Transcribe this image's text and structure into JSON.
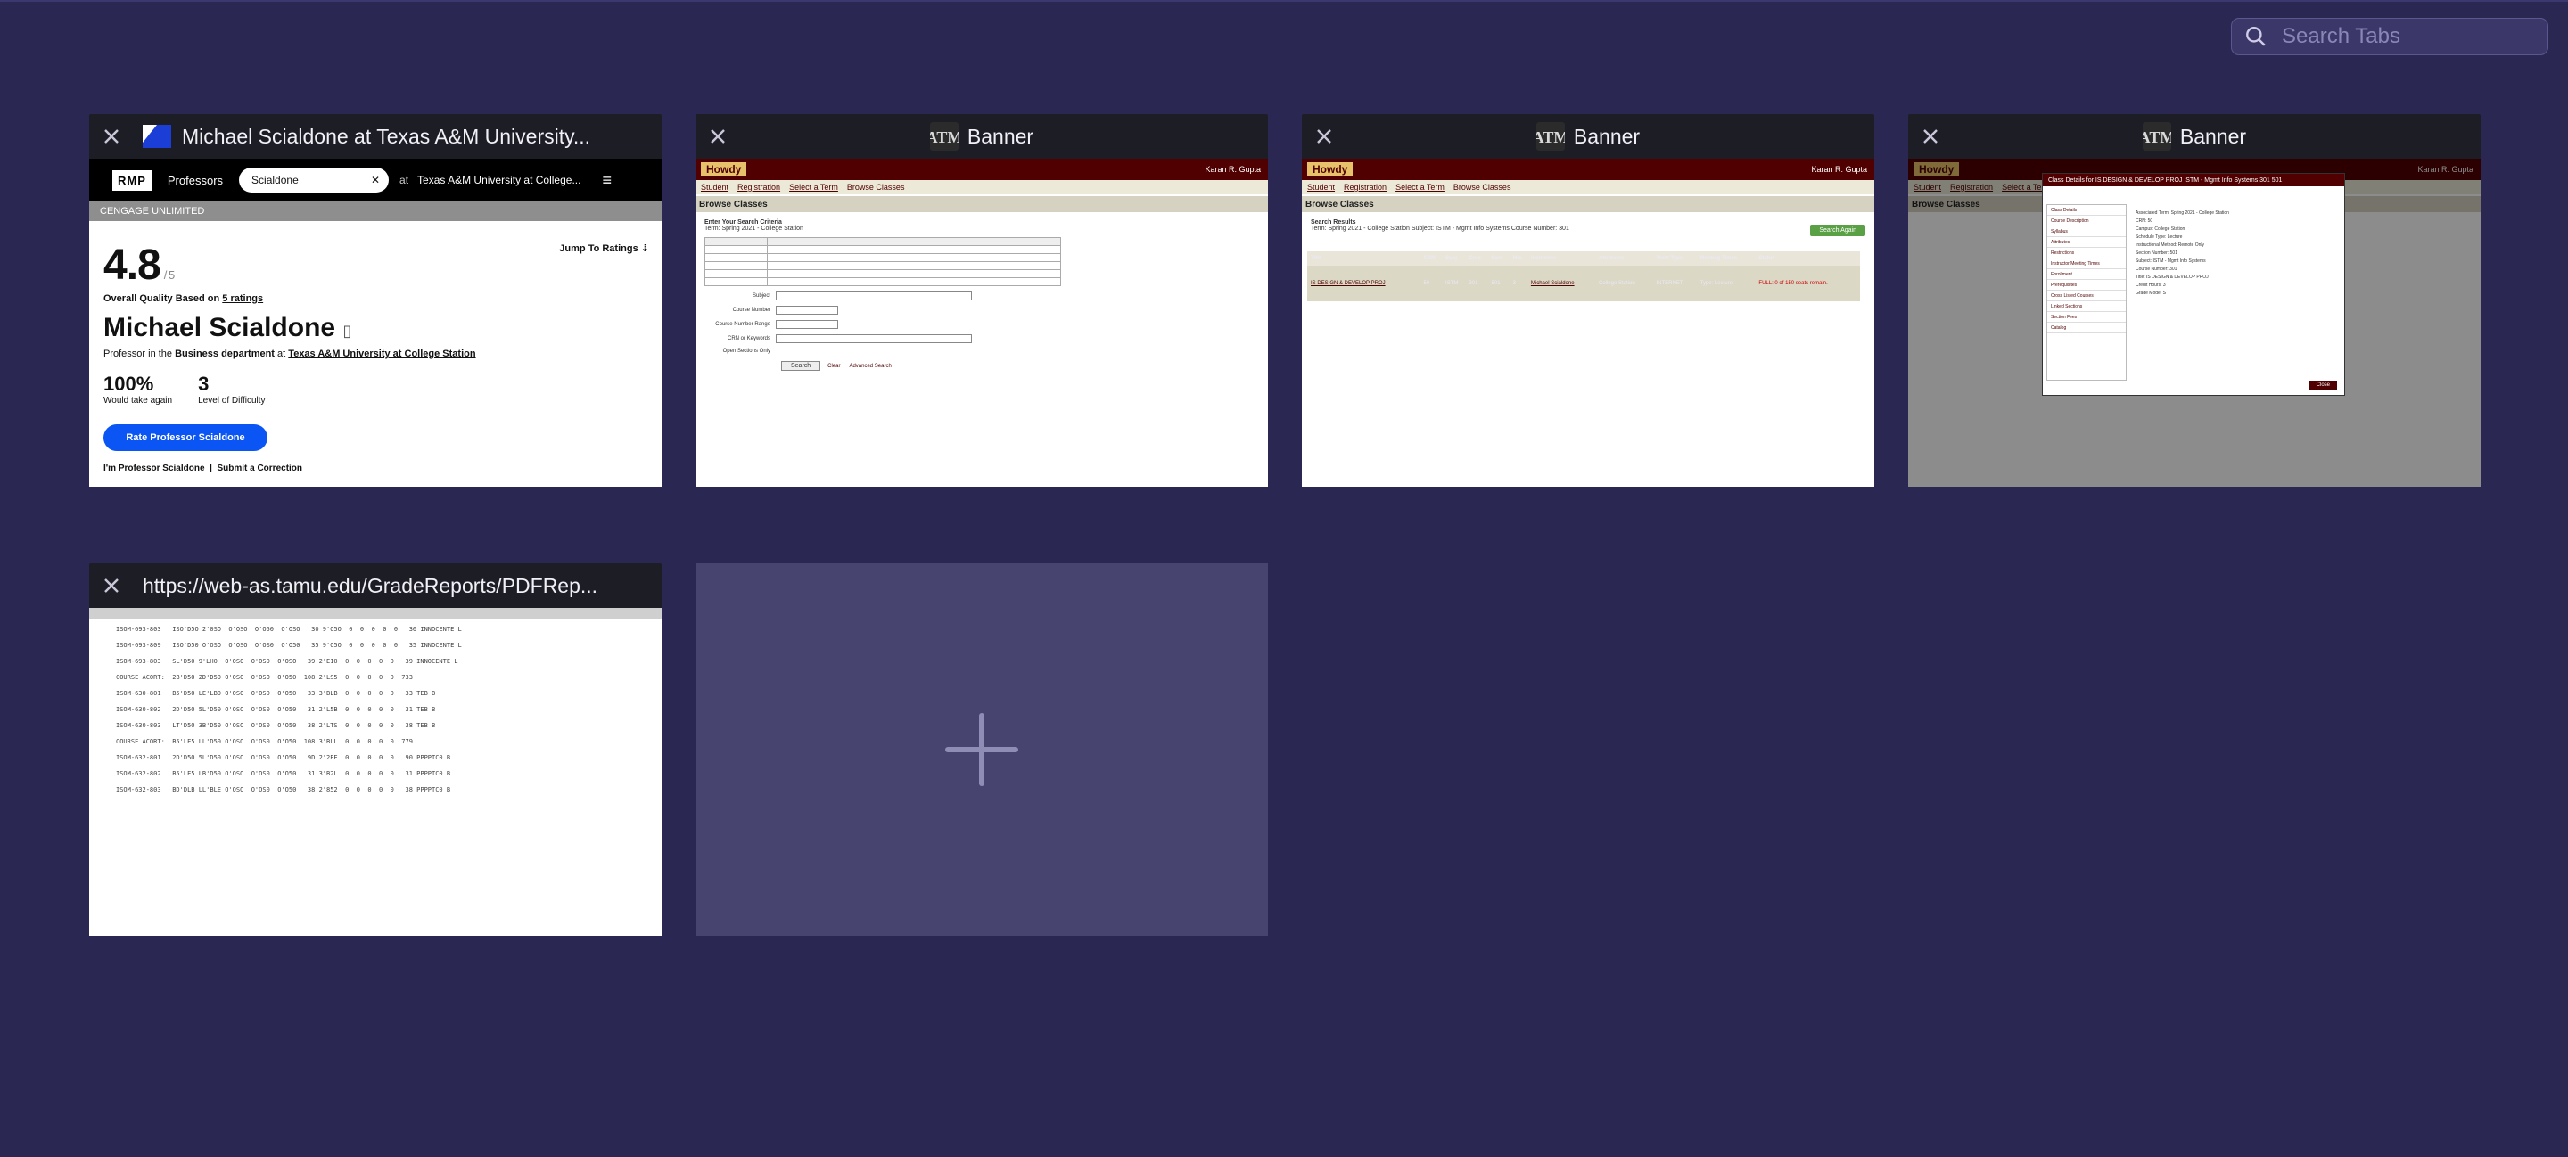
{
  "search": {
    "placeholder": "Search Tabs"
  },
  "tabs": [
    {
      "title": "Michael Scialdone at Texas A&M University...",
      "rmp": {
        "logo": "RMP",
        "professors_menu": "Professors",
        "search_value": "Scialdone",
        "at": "at",
        "school": "Texas A&M University at College...",
        "score": "4.8",
        "score_max": "/ 5",
        "jump": "Jump To Ratings",
        "overall_prefix": "Overall Quality Based on",
        "overall_link": "5 ratings",
        "name": "Michael Scialdone",
        "dept_prefix": "Professor in the",
        "dept": "Business department",
        "dept_at": "at",
        "school_link": "Texas A&M University at College Station",
        "take_again_value": "100%",
        "take_again_label": "Would take again",
        "difficulty_value": "3",
        "difficulty_label": "Level of Difficulty",
        "rate_button": "Rate Professor Scialdone",
        "link_im": "I'm Professor Scialdone",
        "link_correction": "Submit a Correction"
      }
    },
    {
      "title": "Banner"
    },
    {
      "title": "Banner"
    },
    {
      "title": "Banner"
    },
    {
      "title": "https://web-as.tamu.edu/GradeReports/PDFRep..."
    }
  ],
  "banner": {
    "howdy": "Howdy",
    "user": "Karan R. Gupta",
    "crumbs": [
      "Student",
      "Registration",
      "Select a Term",
      "Browse Classes"
    ],
    "heading": "Browse Classes",
    "search_heading": "Enter Your Search Criteria",
    "term": "Term: Spring 2021 - College Station",
    "fields": [
      "Subject",
      "Course Number",
      "Course Number Range",
      "CRN or Keywords",
      "Open Sections Only"
    ],
    "search_button": "Search",
    "clear": "Clear",
    "advanced": "Advanced Search",
    "results_heading": "Search Results",
    "results_meta": "Term: Spring 2021 - College Station   Subject: ISTM - Mgmt Info Systems   Course Number: 301",
    "search_again": "Search Again",
    "columns": [
      "Title",
      "CRN",
      "Subj",
      "Crse",
      "Sect",
      "Hrs",
      "Instructor",
      "Attributes",
      "Term Type",
      "Meeting Times",
      "Status"
    ],
    "row": [
      "IS DESIGN & DEVELOP PROJ",
      "50",
      "ISTM",
      "301",
      "501",
      "3",
      "Michael Scialdone",
      "College Station",
      "INTERNET",
      "Type: Lecture",
      "FULL: 0 of 150 seats remain."
    ],
    "modal_title": "Class Details for IS DESIGN & DEVELOP PROJ ISTM - Mgmt Info Systems 301 501",
    "modal_items": [
      "Class Details",
      "Course Description",
      "Syllabus",
      "Attributes",
      "Restrictions",
      "Instructor/Meeting Times",
      "Enrollment",
      "Prerequisites",
      "Cross Listed Courses",
      "Linked Sections",
      "Section Fees",
      "Catalog"
    ],
    "modal_detail": [
      "Associated Term: Spring 2021 - College Station",
      "CRN: 50",
      "Campus: College Station",
      "Schedule Type: Lecture",
      "Instructional Method: Remote Only",
      "Section Number: 501",
      "Subject: ISTM - Mgmt Info Systems",
      "Course Number: 301",
      "Title: IS DESIGN & DEVELOP PROJ",
      "Credit Hours: 3",
      "Grade Mode: S"
    ],
    "close_button": "Close"
  },
  "pdf": {
    "lines": [
      "ISOM-693-803   ISO'D5O 2'0SO  O'OSO  O'O50  O'OSO   30 9'O5O  0  0  0  0  0   30 INNOCENTE L",
      "ISOM-693-809   ISO'D50 O'OSO  O'OSO  O'OS0  O'O50   35 9'O5O  0  0  0  0  0   35 INNOCENTE L",
      "ISOM-693-803   SL'D50 9'LH0  O'OSO  O'OS0  O'OSO   39 2'E10  0  0  0  0  0   39 INNOCENTE L",
      "COURSE ACORT:  2B'D5O 2D'D50 O'OSO  O'OSO  O'O50  108 2'LS5  0  0  0  0  0  733",
      "ISOM-630-801   B5'D5O LE'LB0 O'OSO  O'OS0  O'O50   33 3'BLB  0  0  0  0  0   33 TEB B",
      "ISOM-630-802   2D'D5O 5L'D50 O'OSO  O'OS0  O'O50   31 2'L5B  0  0  0  0  0   31 TEB B",
      "ISOM-630-803   LT'D5O 3B'D50 O'OSO  O'OS0  O'O50   38 2'LTS  0  0  0  0  0   38 TEB B",
      "COURSE ACORT:  B5'LE5 LL'D50 O'OSO  O'OS0  O'O50  108 3'BLL  0  0  0  0  0  779",
      "ISOM-632-801   2D'D5O 5L'D50 O'OSO  O'OS0  O'O50   9D 2'2EE  0  0  0  0  0   90 PPPPTC0 B",
      "ISOM-632-802   B5'LE5 LB'D50 O'OSO  O'OS0  O'O50   31 3'B2L  0  0  0  0  0   31 PPPPTC0 B",
      "ISOM-632-803   BD'DLB LL'BLE O'OSO  O'OS0  O'O50   38 2'852  0  0  0  0  0   38 PPPPTC0 B"
    ]
  }
}
